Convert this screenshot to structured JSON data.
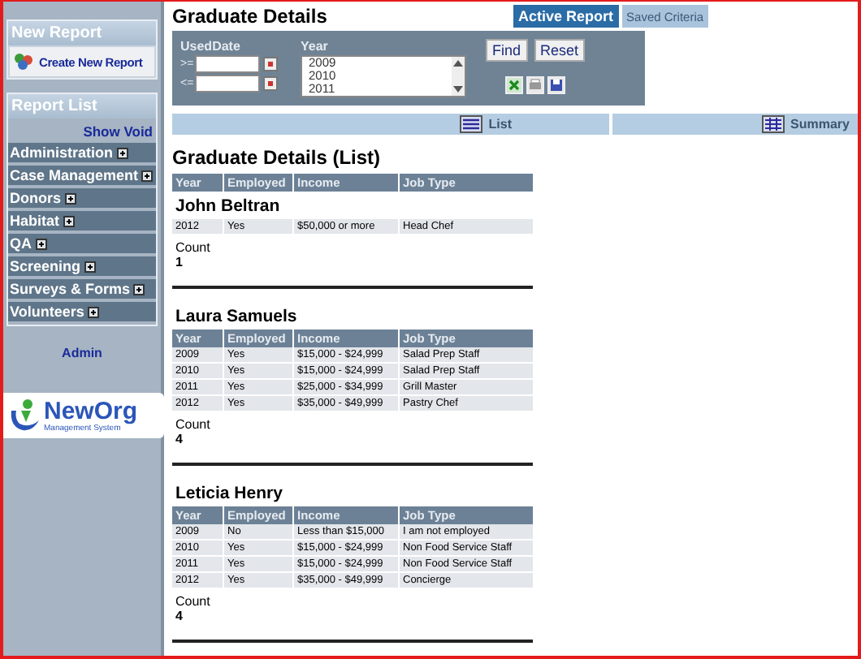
{
  "sidebar": {
    "new_report": {
      "title": "New Report",
      "link": "Create New Report"
    },
    "report_list": {
      "title": "Report List",
      "show_void": "Show Void",
      "items": [
        {
          "label": "Administration",
          "expanded": false
        },
        {
          "label": "Case Management",
          "expanded": false
        },
        {
          "label": "Donors",
          "expanded": false
        },
        {
          "label": "Habitat",
          "expanded": false
        },
        {
          "label": "QA",
          "expanded": false
        },
        {
          "label": "Screening",
          "expanded": false
        },
        {
          "label": "Surveys & Forms",
          "expanded": false
        },
        {
          "label": "Volunteers",
          "expanded": false
        }
      ]
    },
    "admin": "Admin",
    "logo": {
      "name": "NewOrg",
      "tagline": "Management System"
    }
  },
  "page_title": "Graduate Details",
  "tabs": [
    {
      "label": "Active Report",
      "selected": true
    },
    {
      "label": "Saved Criteria",
      "selected": false
    }
  ],
  "filters": {
    "used_date": {
      "label": "UsedDate",
      "from_label": ">=",
      "to_label": "<="
    },
    "year": {
      "label": "Year",
      "options": [
        "2009",
        "2010",
        "2011"
      ]
    },
    "buttons": [
      "Find",
      "Reset"
    ]
  },
  "view_bar": {
    "list": "List",
    "summary": "Summary"
  },
  "list": {
    "title": "Graduate Details (List)",
    "columns": [
      "Year",
      "Employed",
      "Income",
      "Job Type"
    ],
    "groups": [
      {
        "name": "John Beltran",
        "rows": [
          [
            "2012",
            "Yes",
            "$50,000 or more",
            "Head Chef"
          ]
        ],
        "count_label": "Count",
        "count": "1"
      },
      {
        "name": "Laura Samuels",
        "columns": [
          "Year",
          "Employed",
          "Income",
          "Job Type"
        ],
        "rows": [
          [
            "2009",
            "Yes",
            "$15,000 - $24,999",
            "Salad Prep Staff"
          ],
          [
            "2010",
            "Yes",
            "$15,000 - $24,999",
            "Salad Prep Staff"
          ],
          [
            "2011",
            "Yes",
            "$25,000 - $34,999",
            "Grill Master"
          ],
          [
            "2012",
            "Yes",
            "$35,000 - $49,999",
            "Pastry Chef"
          ]
        ],
        "count_label": "Count",
        "count": "4"
      },
      {
        "name": "Leticia Henry",
        "columns": [
          "Year",
          "Employed",
          "Income",
          "Job Type"
        ],
        "rows": [
          [
            "2009",
            "No",
            "Less than $15,000",
            "I am not employed"
          ],
          [
            "2010",
            "Yes",
            "$15,000 - $24,999",
            "Non Food Service Staff"
          ],
          [
            "2011",
            "Yes",
            "$15,000 - $24,999",
            "Non Food Service Staff"
          ],
          [
            "2012",
            "Yes",
            "$35,000 - $49,999",
            "Concierge"
          ]
        ],
        "count_label": "Count",
        "count": "4"
      }
    ]
  }
}
